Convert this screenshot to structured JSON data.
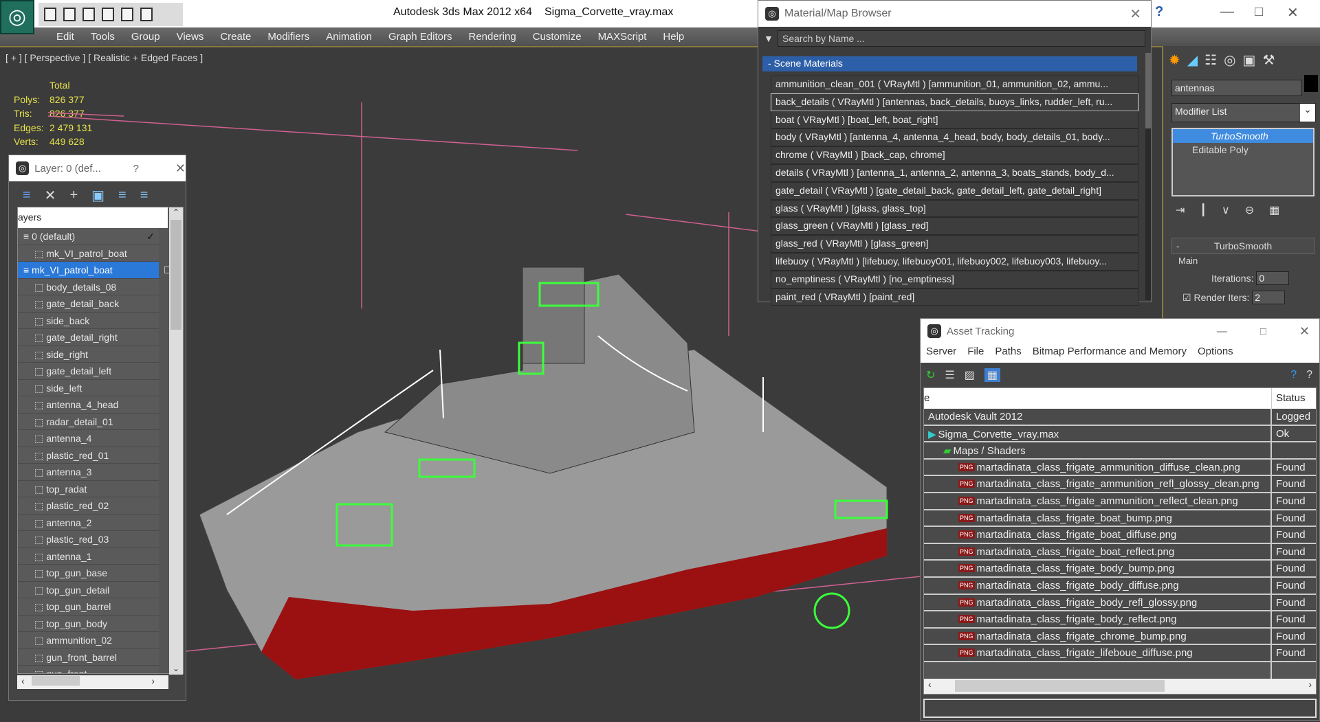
{
  "window": {
    "app_title": "Autodesk 3ds Max  2012 x64",
    "file": "Sigma_Corvette_vray.max",
    "help_icon": "?"
  },
  "menu": [
    "Edit",
    "Tools",
    "Group",
    "Views",
    "Create",
    "Modifiers",
    "Animation",
    "Graph Editors",
    "Rendering",
    "Customize",
    "MAXScript",
    "Help"
  ],
  "viewport": {
    "label": "[ + ] [ Perspective ] [ Realistic + Edged Faces ]",
    "stats": {
      "header": "Total",
      "rows": [
        {
          "k": "Polys:",
          "v": "826 377"
        },
        {
          "k": "Tris:",
          "v": "826 377"
        },
        {
          "k": "Edges:",
          "v": "2 479 131"
        },
        {
          "k": "Verts:",
          "v": "449 628"
        }
      ]
    },
    "colors": {
      "hull": "#9a9a9a",
      "bottom": "#9b1010",
      "selection": "#3cff3c",
      "grid": "#d06090"
    }
  },
  "layer_dialog": {
    "title": "Layer: 0 (def...",
    "help": "?",
    "column": "ayers",
    "items": [
      {
        "name": "0 (default)",
        "type": "layer",
        "active": true
      },
      {
        "name": "mk_VI_patrol_boat",
        "type": "object"
      },
      {
        "name": "mk_VI_patrol_boat",
        "type": "layer",
        "selected": true
      },
      {
        "name": "body_details_08"
      },
      {
        "name": "gate_detail_back"
      },
      {
        "name": "side_back"
      },
      {
        "name": "gate_detail_right"
      },
      {
        "name": "side_right"
      },
      {
        "name": "gate_detail_left"
      },
      {
        "name": "side_left"
      },
      {
        "name": "antenna_4_head"
      },
      {
        "name": "radar_detail_01"
      },
      {
        "name": "antenna_4"
      },
      {
        "name": "plastic_red_01"
      },
      {
        "name": "antenna_3"
      },
      {
        "name": "top_radat"
      },
      {
        "name": "plastic_red_02"
      },
      {
        "name": "antenna_2"
      },
      {
        "name": "plastic_red_03"
      },
      {
        "name": "antenna_1"
      },
      {
        "name": "top_gun_base"
      },
      {
        "name": "top_gun_detail"
      },
      {
        "name": "top_gun_barrel"
      },
      {
        "name": "top_gun_body"
      },
      {
        "name": "ammunition_02"
      },
      {
        "name": "gun_front_barrel"
      },
      {
        "name": "gun_front"
      }
    ]
  },
  "material_browser": {
    "title": "Material/Map Browser",
    "search_placeholder": "Search by Name ...",
    "section": "- Scene Materials",
    "items": [
      "ammunition_clean_001  ( VRayMtl )  [ammunition_01, ammunition_02, ammu...",
      "back_details ( VRayMtl ) [antennas, back_details, buoys_links, rudder_left, ru...",
      "boat  ( VRayMtl ) [boat_left, boat_right]",
      "body  ( VRayMtl ) [antenna_4, antenna_4_head, body, body_details_01, body...",
      "chrome  ( VRayMtl ) [back_cap, chrome]",
      "details  ( VRayMtl ) [antenna_1, antenna_2, antenna_3, boats_stands, body_d...",
      "gate_detail  ( VRayMtl ) [gate_detail_back, gate_detail_left, gate_detail_right]",
      "glass  ( VRayMtl ) [glass, glass_top]",
      "glass_green  ( VRayMtl ) [glass_red]",
      "glass_red  ( VRayMtl ) [glass_green]",
      "lifebuoy  ( VRayMtl ) [lifebuoy, lifebuoy001, lifebuoy002, lifebuoy003, lifebuoy...",
      "no_emptiness  ( VRayMtl ) [no_emptiness]",
      "paint_red  ( VRayMtl ) [paint_red]"
    ],
    "selected_index": 1
  },
  "command_panel": {
    "object_name": "antennas",
    "modifier_list": "Modifier List",
    "stack": [
      "TurboSmooth",
      "Editable Poly"
    ],
    "rollout": "TurboSmooth",
    "group": "Main",
    "iterations_label": "Iterations:",
    "iterations": "0",
    "render_iters_label": "Render Iters:",
    "render_iters": "2",
    "render_iters_checked": true
  },
  "asset_tracking": {
    "title": "Asset Tracking",
    "menu": [
      "Server",
      "File",
      "Paths",
      "Bitmap Performance and Memory",
      "Options"
    ],
    "columns": [
      "e",
      "Status"
    ],
    "rows": [
      {
        "name": "Autodesk Vault 2012",
        "status": "Logged",
        "level": 0
      },
      {
        "name": "Sigma_Corvette_vray.max",
        "status": "Ok",
        "level": 0
      },
      {
        "name": "Maps / Shaders",
        "status": "",
        "level": 1
      },
      {
        "name": "martadinata_class_frigate_ammunition_diffuse_clean.png",
        "status": "Found",
        "level": 2
      },
      {
        "name": "martadinata_class_frigate_ammunition_refl_glossy_clean.png",
        "status": "Found",
        "level": 2
      },
      {
        "name": "martadinata_class_frigate_ammunition_reflect_clean.png",
        "status": "Found",
        "level": 2
      },
      {
        "name": "martadinata_class_frigate_boat_bump.png",
        "status": "Found",
        "level": 2
      },
      {
        "name": "martadinata_class_frigate_boat_diffuse.png",
        "status": "Found",
        "level": 2
      },
      {
        "name": "martadinata_class_frigate_boat_reflect.png",
        "status": "Found",
        "level": 2
      },
      {
        "name": "martadinata_class_frigate_body_bump.png",
        "status": "Found",
        "level": 2
      },
      {
        "name": "martadinata_class_frigate_body_diffuse.png",
        "status": "Found",
        "level": 2
      },
      {
        "name": "martadinata_class_frigate_body_refl_glossy.png",
        "status": "Found",
        "level": 2
      },
      {
        "name": "martadinata_class_frigate_body_reflect.png",
        "status": "Found",
        "level": 2
      },
      {
        "name": "martadinata_class_frigate_chrome_bump.png",
        "status": "Found",
        "level": 2
      },
      {
        "name": "martadinata_class_frigate_lifeboue_diffuse.png",
        "status": "Found",
        "level": 2
      }
    ],
    "png_badge": "PNG"
  }
}
